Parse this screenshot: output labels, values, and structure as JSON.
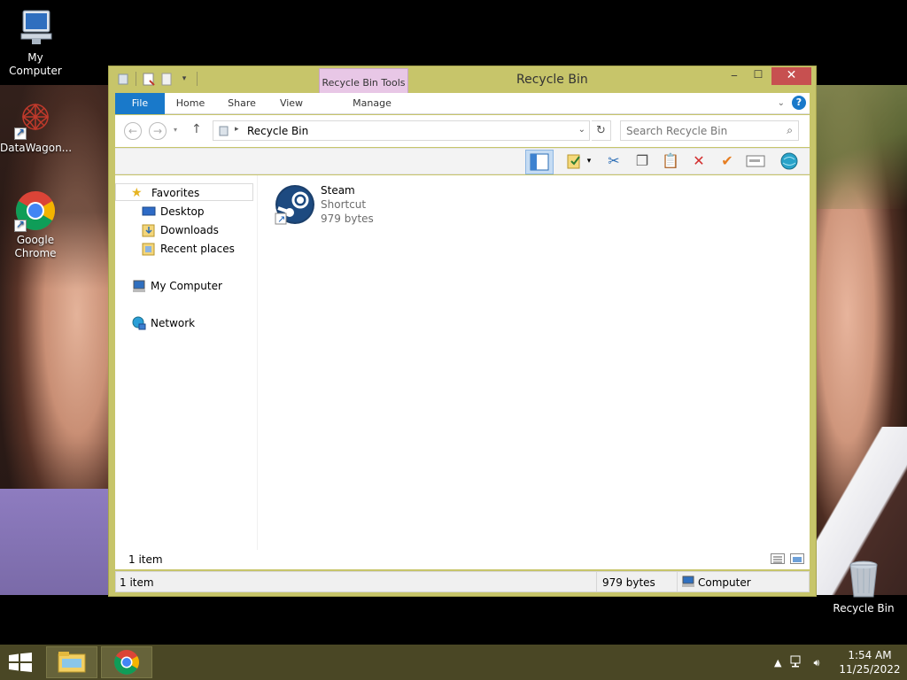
{
  "desktop": {
    "icons": [
      {
        "label": "My Computer"
      },
      {
        "label": "DataWagon..."
      },
      {
        "label": "Google Chrome"
      },
      {
        "label": "Recycle Bin"
      }
    ]
  },
  "window": {
    "title": "Recycle Bin",
    "context_tab": "Recycle Bin Tools",
    "tabs": {
      "file": "File",
      "home": "Home",
      "share": "Share",
      "view": "View",
      "manage": "Manage"
    },
    "buttons": {
      "minimize": "‒",
      "maximize": "☐",
      "close": "✕",
      "help": "?"
    },
    "address": {
      "crumb": "Recycle Bin"
    },
    "search": {
      "placeholder": "Search Recycle Bin"
    },
    "nav_pane": {
      "favorites": "Favorites",
      "desktop": "Desktop",
      "downloads": "Downloads",
      "recent": "Recent places",
      "computer": "My Computer",
      "network": "Network"
    },
    "files": [
      {
        "name": "Steam",
        "type": "Shortcut",
        "size": "979 bytes"
      }
    ],
    "item_count": "1 item",
    "status": {
      "items": "1 item",
      "size": "979 bytes",
      "location": "Computer"
    }
  },
  "taskbar": {
    "time": "1:54 AM",
    "date": "11/25/2022"
  },
  "colors": {
    "window_frame": "#c7c56a",
    "file_tab": "#1979ca",
    "context_tab": "#e8c7e6",
    "close_button": "#c75050",
    "taskbar": "#4a4725"
  }
}
